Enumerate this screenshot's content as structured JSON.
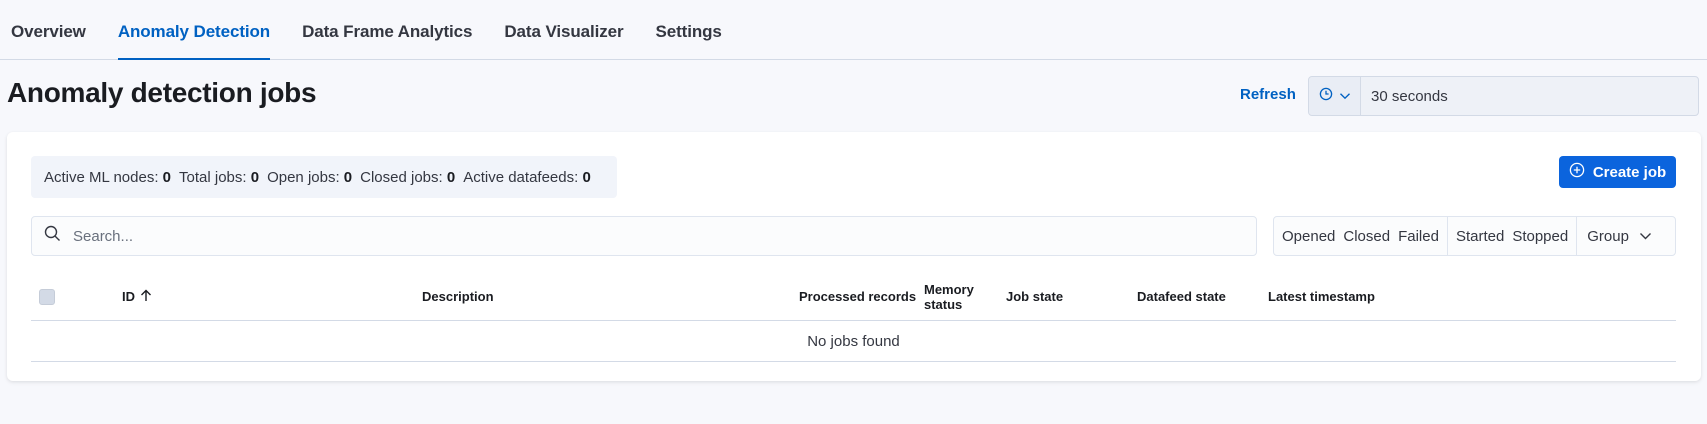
{
  "tabs": [
    {
      "label": "Overview",
      "active": false
    },
    {
      "label": "Anomaly Detection",
      "active": true
    },
    {
      "label": "Data Frame Analytics",
      "active": false
    },
    {
      "label": "Data Visualizer",
      "active": false
    },
    {
      "label": "Settings",
      "active": false
    }
  ],
  "header": {
    "title": "Anomaly detection jobs",
    "refresh_label": "Refresh",
    "refresh_interval": "30 seconds",
    "interval_icon": "clock-icon"
  },
  "stats": {
    "active_ml_nodes_label": "Active ML nodes:",
    "active_ml_nodes": "0",
    "total_jobs_label": "Total jobs:",
    "total_jobs": "0",
    "open_jobs_label": "Open jobs:",
    "open_jobs": "0",
    "closed_jobs_label": "Closed jobs:",
    "closed_jobs": "0",
    "active_datafeeds_label": "Active datafeeds:",
    "active_datafeeds": "0"
  },
  "create_job_label": "Create job",
  "search": {
    "placeholder": "Search..."
  },
  "filters": {
    "job_state": [
      "Opened",
      "Closed",
      "Failed"
    ],
    "datafeed_state": [
      "Started",
      "Stopped"
    ],
    "group_label": "Group"
  },
  "table": {
    "columns": {
      "id": "ID",
      "description": "Description",
      "processed_records": "Processed records",
      "memory_status_line1": "Memory",
      "memory_status_line2": "status",
      "job_state": "Job state",
      "datafeed_state": "Datafeed state",
      "latest_timestamp": "Latest timestamp"
    },
    "sort_column": "ID",
    "sort_direction": "ascending",
    "empty_message": "No jobs found"
  },
  "colors": {
    "accent": "#0061c2",
    "primary_button": "#0b64dd",
    "page_background": "#f7f8fc"
  }
}
